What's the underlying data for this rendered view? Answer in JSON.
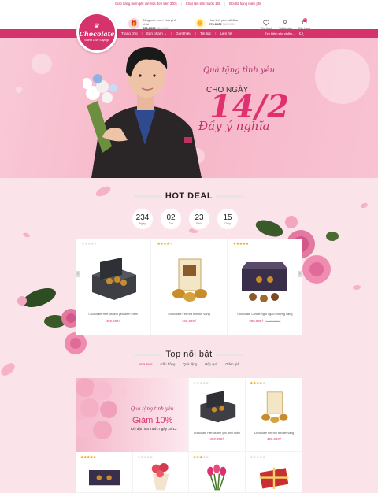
{
  "topbar": {
    "items": [
      "Giao hàng miễn phí với hóa đơn trên 300k",
      "Chất liệu làm muốn 16h",
      "Đổi trả hàng miễn phí"
    ]
  },
  "brand": {
    "name": "Chocolate",
    "tagline": "Sweet Love Sayings"
  },
  "header": {
    "mini_products": [
      {
        "name": "Tặng cúc em – Hoa phở nhật",
        "price": "650.000₫",
        "old_price": "850.000₫"
      },
      {
        "name": "Hoa tinh yêu bất đầu",
        "price": "270.000₫",
        "old_price": "360.000₫"
      }
    ],
    "icons": [
      {
        "name": "heart-icon",
        "label": "Yêu thích"
      },
      {
        "name": "user-icon",
        "label": "Tài khoản"
      },
      {
        "name": "cart-icon",
        "label": "Giỏ hàng",
        "badge": "0"
      }
    ]
  },
  "nav": {
    "items": [
      "Trang chủ",
      "Sản phẩm",
      "Giới thiệu",
      "Tin tức",
      "Liên hệ"
    ],
    "search_placeholder": "Tìm kiếm sản phẩm..."
  },
  "hero": {
    "script": "Quà tặng tình yêu",
    "line": "CHO NGÀY",
    "date": "14/2",
    "tagline": "Đầy ý nghĩa"
  },
  "hotdeal": {
    "title": "HOT DEAL",
    "countdown": [
      {
        "n": "234",
        "l": "Ngày"
      },
      {
        "n": "02",
        "l": "Giờ"
      },
      {
        "n": "23",
        "l": "Phút"
      },
      {
        "n": "15",
        "l": "Giây"
      }
    ],
    "products": [
      {
        "name": "Chocolate Hiết đá tinh yêu đêm thắm",
        "price": "490.000₫",
        "old": "",
        "stars": 0
      },
      {
        "name": "Chocolate Ferrora tinh tim vàng",
        "price": "490.000₫",
        "old": "",
        "stars": 4
      },
      {
        "name": "Chocolate Lancie ngọt ngào thượng hạng",
        "price": "980.000₫",
        "old": "1.500.000₫",
        "stars": 5
      }
    ]
  },
  "top": {
    "title": "Top nổi bật",
    "tabs": [
      "Hoa tươi",
      "Gấu bông",
      "Quà tặng",
      "Hộp quà",
      "Giảm giá"
    ],
    "banner": {
      "script": "Quà tặng tình yêu",
      "discount": "Giảm 10%",
      "note": "Khi đặt hoa trước ngày 20/12"
    },
    "products": [
      {
        "name": "Chocolate Hiết đá tinh yêu đêm thắm",
        "price": "490.000₫",
        "stars": 0
      },
      {
        "name": "Chocolate Ferrora tinh tim vàng",
        "price": "490.000₫",
        "stars": 4
      }
    ]
  },
  "colors": {
    "accent": "#d6336c",
    "pink_bg": "#fbe3ea"
  }
}
